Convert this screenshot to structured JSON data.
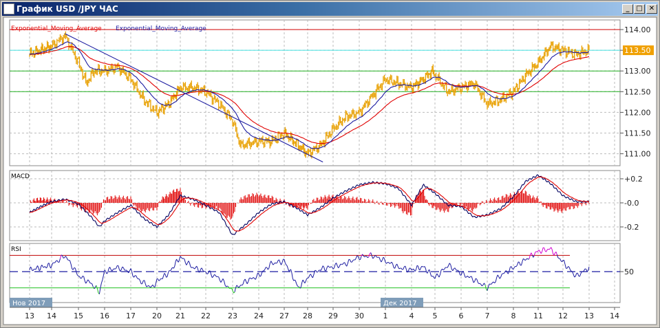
{
  "window": {
    "title": "График USD /JPY  ЧАС",
    "minimize_icon": "minimize-icon",
    "maximize_icon": "maximize-icon",
    "close_icon": "close-icon"
  },
  "price_pane": {
    "legend": [
      {
        "label": "Exponential_Moving_Average",
        "color": "#e00000"
      },
      {
        "label": "Exponential_Moving_Average",
        "color": "#1a1aa0"
      }
    ],
    "axis_labels": [
      "114.00",
      "113.50",
      "113.00",
      "112.50",
      "112.00",
      "111.50",
      "111.00"
    ],
    "current_price": "113.50",
    "levels": [
      {
        "value": 114.0,
        "color": "#d00000"
      },
      {
        "value": 113.5,
        "color": "#40e0e0"
      },
      {
        "value": 113.0,
        "color": "#20b020"
      },
      {
        "value": 112.5,
        "color": "#20b020"
      }
    ]
  },
  "macd_pane": {
    "label": "MACD",
    "axis_labels": [
      "+0.2",
      "-0.0",
      "-0.2"
    ]
  },
  "rsi_pane": {
    "label": "RSI",
    "axis_labels": [
      "50"
    ],
    "upper": 70,
    "lower": 30
  },
  "month_labels": [
    "Нов 2017",
    "Дек 2017"
  ],
  "dates": [
    "13",
    "14",
    "15",
    "16",
    "17",
    "20",
    "21",
    "22",
    "23",
    "24",
    "27",
    "28",
    "29",
    "30",
    "1",
    "4",
    "5",
    "6",
    "7",
    "8",
    "11",
    "12",
    "13",
    "14"
  ],
  "chart_data": {
    "type": "line",
    "title": "График USD /JPY  ЧАС",
    "x_index_note": "day index into dates",
    "price": [
      [
        0,
        113.4
      ],
      [
        0.5,
        113.5
      ],
      [
        1,
        113.6
      ],
      [
        1.5,
        113.85
      ],
      [
        2,
        113.2
      ],
      [
        2.3,
        112.7
      ],
      [
        2.6,
        113.0
      ],
      [
        3,
        113.0
      ],
      [
        3.5,
        113.1
      ],
      [
        4,
        112.8
      ],
      [
        4.5,
        112.3
      ],
      [
        5,
        112.0
      ],
      [
        5.5,
        112.2
      ],
      [
        6,
        112.6
      ],
      [
        6.5,
        112.6
      ],
      [
        7,
        112.5
      ],
      [
        7.5,
        112.2
      ],
      [
        8,
        111.8
      ],
      [
        8.3,
        111.2
      ],
      [
        9,
        111.3
      ],
      [
        9.5,
        111.3
      ],
      [
        10,
        111.5
      ],
      [
        10.6,
        111.2
      ],
      [
        11,
        111.0
      ],
      [
        11.5,
        111.2
      ],
      [
        12,
        111.6
      ],
      [
        12.5,
        111.9
      ],
      [
        13,
        112.0
      ],
      [
        13.5,
        112.4
      ],
      [
        14,
        112.8
      ],
      [
        14.5,
        112.7
      ],
      [
        15,
        112.6
      ],
      [
        15.5,
        112.8
      ],
      [
        15.9,
        113.0
      ],
      [
        16,
        112.9
      ],
      [
        16.5,
        112.5
      ],
      [
        17,
        112.6
      ],
      [
        17.5,
        112.7
      ],
      [
        18,
        112.2
      ],
      [
        18.5,
        112.3
      ],
      [
        19,
        112.5
      ],
      [
        19.5,
        112.9
      ],
      [
        20,
        113.2
      ],
      [
        20.5,
        113.6
      ],
      [
        21,
        113.5
      ],
      [
        21.5,
        113.4
      ],
      [
        22,
        113.5
      ]
    ],
    "trendline": [
      [
        1.5,
        113.9
      ],
      [
        11.6,
        110.8
      ]
    ],
    "macd": [
      [
        0,
        -0.08
      ],
      [
        0.5,
        -0.03
      ],
      [
        1,
        0.01
      ],
      [
        1.5,
        0.03
      ],
      [
        2,
        -0.01
      ],
      [
        2.5,
        -0.12
      ],
      [
        2.8,
        -0.2
      ],
      [
        3,
        -0.15
      ],
      [
        3.5,
        -0.08
      ],
      [
        4,
        -0.02
      ],
      [
        4.5,
        -0.13
      ],
      [
        5,
        -0.2
      ],
      [
        5.5,
        -0.1
      ],
      [
        6,
        0.06
      ],
      [
        6.5,
        0.03
      ],
      [
        7,
        -0.02
      ],
      [
        7.5,
        -0.08
      ],
      [
        8,
        -0.27
      ],
      [
        8.5,
        -0.18
      ],
      [
        9,
        -0.08
      ],
      [
        9.5,
        -0.01
      ],
      [
        10,
        0.01
      ],
      [
        10.5,
        -0.04
      ],
      [
        11,
        -0.1
      ],
      [
        11.5,
        -0.04
      ],
      [
        12,
        0.04
      ],
      [
        12.5,
        0.1
      ],
      [
        13,
        0.15
      ],
      [
        13.5,
        0.17
      ],
      [
        14,
        0.16
      ],
      [
        14.5,
        0.12
      ],
      [
        15,
        -0.02
      ],
      [
        15.5,
        0.15
      ],
      [
        16,
        0.08
      ],
      [
        16.5,
        -0.02
      ],
      [
        17,
        -0.03
      ],
      [
        17.5,
        -0.12
      ],
      [
        18,
        -0.1
      ],
      [
        18.5,
        -0.05
      ],
      [
        19,
        0.05
      ],
      [
        19.5,
        0.18
      ],
      [
        20,
        0.23
      ],
      [
        20.5,
        0.16
      ],
      [
        21,
        0.06
      ],
      [
        21.5,
        0.01
      ],
      [
        22,
        0.01
      ]
    ],
    "rsi": [
      [
        0,
        52
      ],
      [
        0.5,
        55
      ],
      [
        1,
        58
      ],
      [
        1.5,
        70
      ],
      [
        2,
        45
      ],
      [
        2.5,
        35
      ],
      [
        2.8,
        25
      ],
      [
        3,
        50
      ],
      [
        3.5,
        55
      ],
      [
        4,
        50
      ],
      [
        4.3,
        40
      ],
      [
        4.8,
        30
      ],
      [
        5,
        38
      ],
      [
        5.5,
        48
      ],
      [
        6,
        68
      ],
      [
        6.5,
        55
      ],
      [
        7,
        50
      ],
      [
        7.5,
        42
      ],
      [
        8,
        26
      ],
      [
        8.5,
        38
      ],
      [
        9,
        45
      ],
      [
        9.5,
        60
      ],
      [
        10,
        63
      ],
      [
        10.3,
        48
      ],
      [
        10.6,
        30
      ],
      [
        11,
        42
      ],
      [
        11.5,
        53
      ],
      [
        12,
        56
      ],
      [
        12.5,
        60
      ],
      [
        13,
        68
      ],
      [
        13.5,
        70
      ],
      [
        14,
        63
      ],
      [
        14.5,
        55
      ],
      [
        15,
        52
      ],
      [
        15.5,
        56
      ],
      [
        16,
        42
      ],
      [
        16.5,
        58
      ],
      [
        17,
        48
      ],
      [
        17.5,
        40
      ],
      [
        18,
        30
      ],
      [
        18.5,
        45
      ],
      [
        19,
        55
      ],
      [
        19.5,
        65
      ],
      [
        20,
        75
      ],
      [
        20.5,
        78
      ],
      [
        21,
        62
      ],
      [
        21.5,
        44
      ],
      [
        22,
        55
      ]
    ],
    "ylim_price": [
      110.7,
      114.25
    ],
    "ylim_macd": [
      -0.3,
      0.27
    ],
    "ylim_rsi": [
      12,
      85
    ]
  }
}
